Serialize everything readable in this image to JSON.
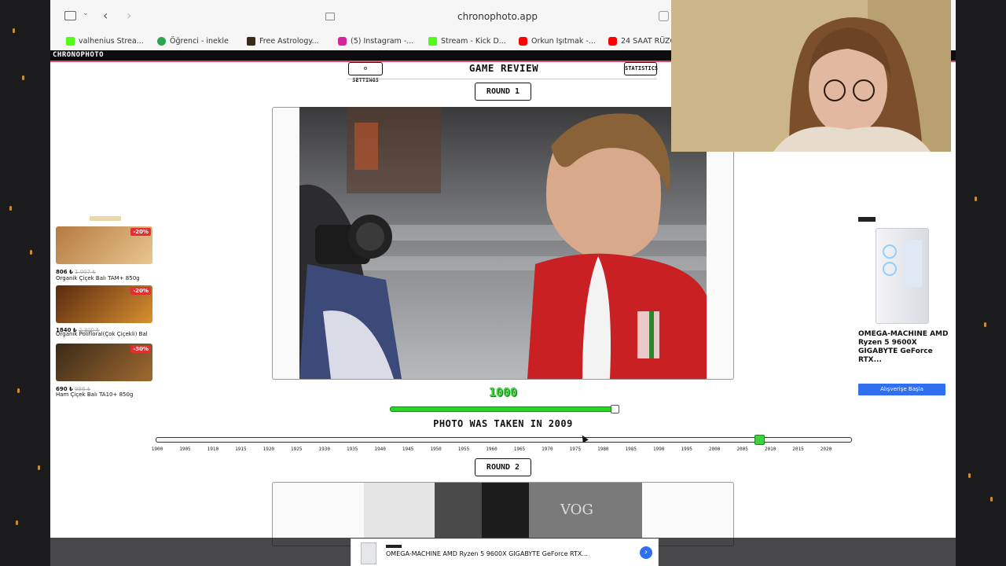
{
  "browser": {
    "address": "chronophoto.app",
    "bookmarks": [
      {
        "label": "valhenius Strea...",
        "color": "#53fc18"
      },
      {
        "label": "Öğrenci - inekle",
        "color": "#2ea44f"
      },
      {
        "label": "Free Astrology...",
        "color": "#3a2a1a"
      },
      {
        "label": "(5) Instagram -...",
        "color": "#d6249f"
      },
      {
        "label": "Stream - Kick D...",
        "color": "#53fc18"
      },
      {
        "label": "Orkun Işıtmak -...",
        "color": "#ff0000"
      },
      {
        "label": "24 SAAT RÜZG...",
        "color": "#ff0000"
      }
    ]
  },
  "site": {
    "brand": "CHRONOPHOTO",
    "settings_label": "⚙ SETTINGS",
    "statistics_label": "STATISTICS",
    "title": "GAME REVIEW"
  },
  "round1": {
    "label": "ROUND 1",
    "score": "1000",
    "score_fraction": 1.0,
    "taken_text": "PHOTO WAS TAKEN IN 2009",
    "guess_year": 2008
  },
  "round2": {
    "label": "ROUND 2"
  },
  "timeline": {
    "years": [
      "1900",
      "1905",
      "1910",
      "1915",
      "1920",
      "1925",
      "1930",
      "1935",
      "1940",
      "1945",
      "1950",
      "1955",
      "1960",
      "1965",
      "1970",
      "1975",
      "1980",
      "1985",
      "1990",
      "1995",
      "2000",
      "2005",
      "2010",
      "2015",
      "2020"
    ]
  },
  "ad_left": {
    "items": [
      {
        "price": "806 ₺",
        "old_price": "1.007 ₺",
        "name": "Organik Çiçek Balı TAM+ 850g",
        "discount": "-20%"
      },
      {
        "price": "1840 ₺",
        "old_price": "2.300 ₺",
        "name": "Organik Polifloral(Çok Çiçekli) Bal",
        "discount": "-20%"
      },
      {
        "price": "690 ₺",
        "old_price": "986 ₺",
        "name": "Ham Çiçek Balı TA10+ 850g",
        "discount": "-30%"
      }
    ]
  },
  "ad_right": {
    "product": "OMEGA-MACHINE AMD Ryzen 5 9600X GIGABYTE GeForce RTX...",
    "button": "Alışverişe Başla"
  },
  "ad_bottom": {
    "product": "OMEGA-MACHINE AMD Ryzen 5 9600X GIGABYTE GeForce RTX..."
  },
  "colors": {
    "accent_green": "#3bd23b",
    "brand_underline": "#e24a6a",
    "ad_blue": "#2f6ff0"
  }
}
